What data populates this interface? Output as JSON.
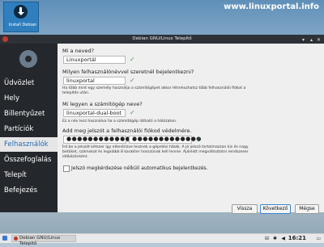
{
  "desktop": {
    "icon_label": "Install Debian",
    "watermark": "www.linuxportal.info"
  },
  "window": {
    "title": "Debian GNU/Linux Telepítő",
    "btn_min": "▾",
    "btn_max": "▴",
    "btn_close": "✕"
  },
  "sidebar": {
    "items": [
      "Üdvözlet",
      "Hely",
      "Billentyűzet",
      "Partíciók",
      "Felhasználók",
      "Összefoglalás",
      "Telepít",
      "Befejezés"
    ],
    "active_index": 4
  },
  "form": {
    "q_name": "Mi a neved?",
    "name_value": "Linuxportál",
    "q_login": "Milyen felhasználónévvel szeretnél bejelentkezni?",
    "login_value": "linuxportal",
    "login_hint1": "Ha több mint egy személy használja a számítógépet akkor létrehozhatsz több felhasználói fiókot a",
    "login_hint2": "telepítés után.",
    "q_host": "Mi legyen a számítógép neve?",
    "host_value": "linuxportal-dual-boot",
    "host_hint": "Ez a név lesz használva ha a számítógép látható a hálózaton.",
    "q_pass": "Add meg jelszót a felhasználói fiókod védelmére.",
    "pass1_value": "●●●●●●●●●●●●●",
    "pass2_value": "●●●●●●●●●●●●●",
    "pass_hint1": "Írd be a jelszót kétszer így ellenőrizve lesznek a gépelési hibák. A jó jelszó tartalmazzon kis és nagy",
    "pass_hint2": "betűket, számokat és legalább 8 karakter hosszúnak kell lennie. Ajánlott megváltoztatni rendszeres",
    "pass_hint3": "időközönként.",
    "autologin_label": "Jelszó megkérdezése nélküli automatikus bejelentkezés.",
    "check": "✓"
  },
  "buttons": {
    "back": "Vissza",
    "next": "Következő",
    "cancel": "Mégse"
  },
  "taskbar": {
    "task": "Debian GNU/Linux Telepítő",
    "clock": "16:21"
  },
  "colors": {
    "active_item": "#2a6cb3",
    "sidebar_bg": "#24272c",
    "check": "#4a9a4a"
  }
}
